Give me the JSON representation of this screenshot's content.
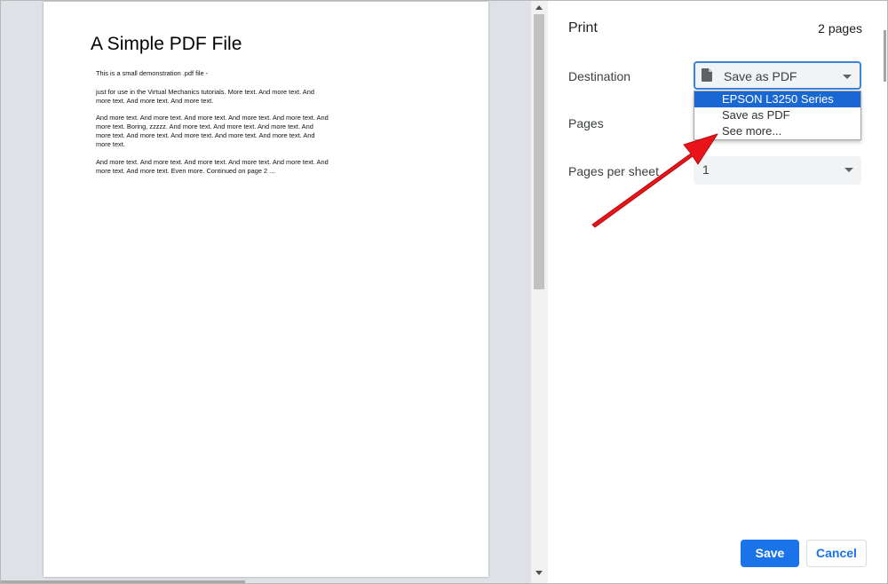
{
  "preview": {
    "doc_title": "A Simple PDF File",
    "paragraphs": [
      "This is a small demonstration .pdf file -",
      "just for use in the Virtual Mechanics tutorials. More text. And more text. And more text. And more text. And more text.",
      "And more text. And more text. And more text. And more text. And more text. And more text. Boring, zzzzz. And more text. And more text. And more text. And more text. And more text. And more text. And more text. And more text. And more text.",
      "And more text. And more text. And more text. And more text. And more text. And more text. And more text. Even more. Continued on page 2 ..."
    ]
  },
  "settings": {
    "title": "Print",
    "page_count": "2 pages",
    "destination": {
      "label": "Destination",
      "value": "Save as PDF",
      "icon": "document-icon",
      "options": [
        "EPSON L3250 Series",
        "Save as PDF",
        "See more..."
      ],
      "highlighted": "EPSON L3250 Series"
    },
    "pages": {
      "label": "Pages"
    },
    "pages_per_sheet": {
      "label": "Pages per sheet",
      "value": "1"
    }
  },
  "buttons": {
    "save": "Save",
    "cancel": "Cancel"
  },
  "colors": {
    "accent": "#1a73e8",
    "highlight": "#1967d2",
    "annotation_arrow": "#e8141a"
  }
}
